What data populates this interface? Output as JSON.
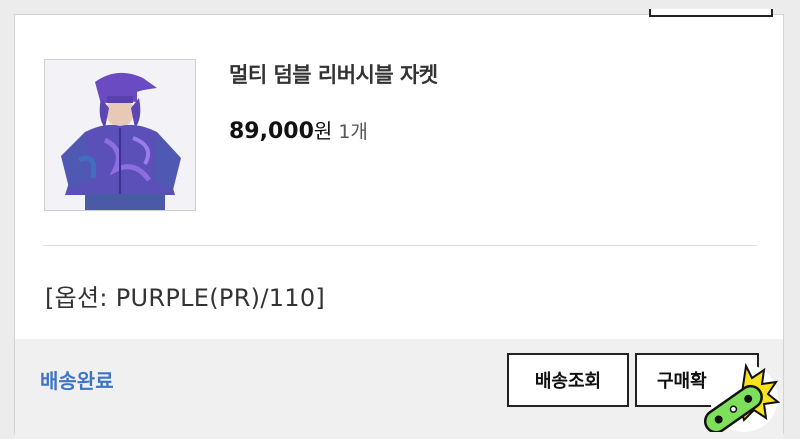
{
  "product": {
    "name": "멀티 덤블 리버시블 자켓",
    "price": "89,000",
    "price_unit": "원",
    "quantity": "1개",
    "option": "[옵션: PURPLE(PR)/110]",
    "image_alt": "purple-reversible-jacket-photo"
  },
  "footer": {
    "status": "배송완료",
    "track_button": "배송조회",
    "confirm_button": "구매확"
  },
  "colors": {
    "status_blue": "#3e74c4",
    "jacket_purple": "#6b4fc6",
    "sticker_green": "#7ee05a"
  }
}
